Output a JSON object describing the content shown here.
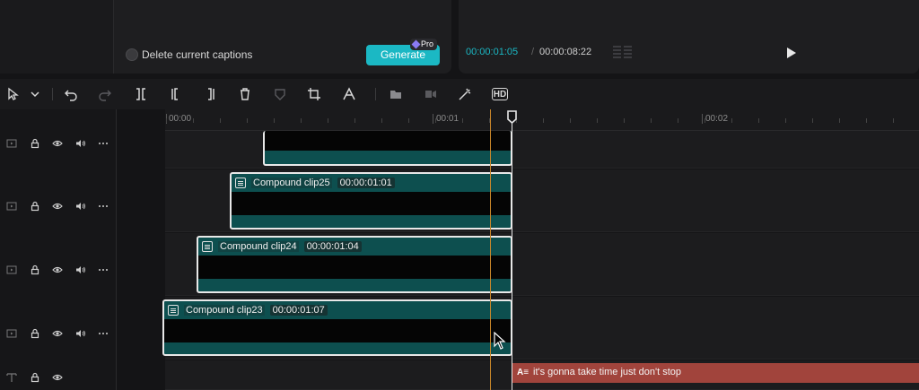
{
  "caption_panel": {
    "delete_captions_label": "Delete current captions",
    "generate_label": "Generate",
    "pro_label": "Pro"
  },
  "player": {
    "current_time": "00:00:01:05",
    "separator": "/",
    "total_time": "00:00:08:22"
  },
  "ruler": {
    "labels": [
      "00:00",
      "00:01",
      "00:02"
    ]
  },
  "tracks": [
    {
      "clip_name": "Compound clip25",
      "duration": "00:00:01:01"
    },
    {
      "clip_name": "Compound clip24",
      "duration": "00:00:01:04"
    },
    {
      "clip_name": "Compound clip23",
      "duration": "00:00:01:07"
    }
  ],
  "caption_track": {
    "icon_text": "A≡",
    "text": "it's gonna take time just don't stop"
  },
  "toolbar": {
    "hd_label": "HD"
  },
  "colors": {
    "accent": "#1bb8c4",
    "clip_fill": "#0d4f4f",
    "caption_fill": "#a1443c",
    "playhead": "#e8e8e8",
    "marker": "#c8862a"
  }
}
